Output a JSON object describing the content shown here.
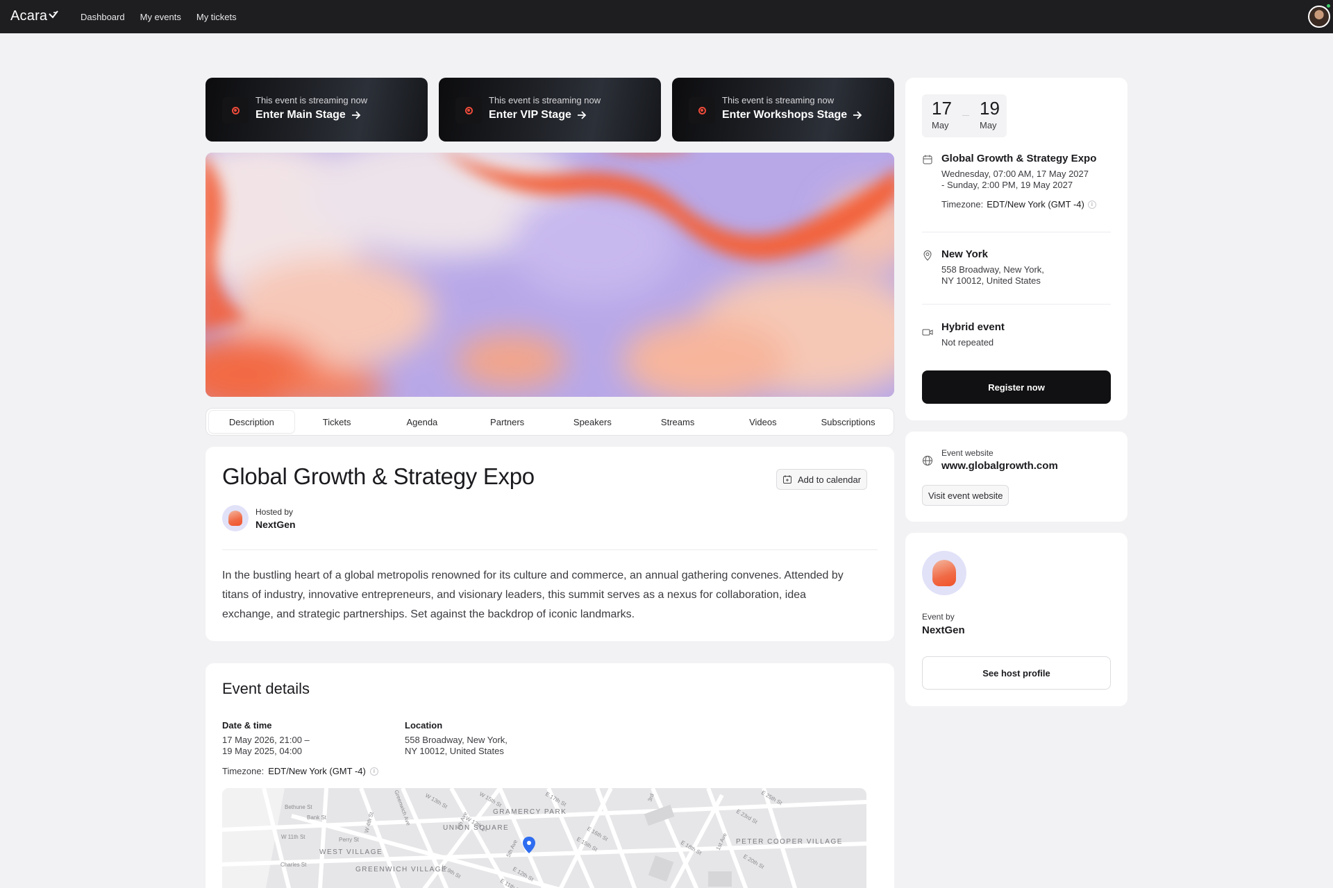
{
  "nav": {
    "logo": "Acara",
    "links": [
      "Dashboard",
      "My events",
      "My tickets"
    ]
  },
  "streams": [
    {
      "status": "This event is streaming now",
      "label": "Enter Main Stage"
    },
    {
      "status": "This event is streaming now",
      "label": "Enter VIP Stage"
    },
    {
      "status": "This event is streaming now",
      "label": "Enter Workshops Stage"
    }
  ],
  "tabs": [
    "Description",
    "Tickets",
    "Agenda",
    "Partners",
    "Speakers",
    "Streams",
    "Videos",
    "Subscriptions"
  ],
  "active_tab": "Description",
  "event": {
    "title": "Global Growth & Strategy Expo",
    "add_to_calendar": "Add to calendar",
    "hosted_by_label": "Hosted by",
    "host": "NextGen",
    "description": "In the bustling heart of a global metropolis renowned for its culture and commerce, an annual gathering convenes. Attended by titans of industry, innovative entrepreneurs, and visionary leaders, this summit serves as a nexus for collaboration, idea exchange, and strategic partnerships. Set against the backdrop of iconic landmarks."
  },
  "details": {
    "heading": "Event details",
    "date_label": "Date & time",
    "date_line1": "17 May 2026, 21:00 –",
    "date_line2": "19 May 2025, 04:00",
    "location_label": "Location",
    "location_line1": "558 Broadway, New York,",
    "location_line2": "NY 10012, United States",
    "timezone_label": "Timezone:",
    "timezone_value": "EDT/New York (GMT -4)",
    "map_labels": [
      "GRAMERCY PARK",
      "UNION SQUARE",
      "WEST VILLAGE",
      "GREENWICH VILLAGE",
      "PETER COOPER VILLAGE",
      "Bethune St",
      "Bank St",
      "W 11th St",
      "Charles St",
      "Perry St",
      "W 4th St",
      "W 13th St",
      "W 15th St",
      "E 17th St",
      "E 23rd St",
      "E 25th St",
      "5th Ave",
      "6th Ave",
      "1st Ave",
      "3rd",
      "E 20th St",
      "E 18th St",
      "E 16th St",
      "E 15th St",
      "W 12th St",
      "W 9th St",
      "E 12th St",
      "E 11th St",
      "Greenwich Ave"
    ]
  },
  "sidebar": {
    "start_day": "17",
    "start_month": "May",
    "end_day": "19",
    "end_month": "May",
    "event_name": "Global Growth & Strategy Expo",
    "datetime_line1": "Wednesday, 07:00 AM, 17 May 2027",
    "datetime_line2": "- Sunday, 2:00 PM, 19 May 2027",
    "timezone_label": "Timezone:",
    "timezone_value": "EDT/New York (GMT -4)",
    "city": "New York",
    "address_line1": "558 Broadway, New York,",
    "address_line2": "NY 10012, United States",
    "format": "Hybrid event",
    "repeat": "Not repeated",
    "register": "Register now",
    "website_label": "Event website",
    "website": "www.globalgrowth.com",
    "visit": "Visit event website",
    "event_by_label": "Event by",
    "event_by": "NextGen",
    "see_host": "See host profile"
  },
  "colors": {
    "topbar": "#1e1e21",
    "accent_orange": "#f05a30",
    "accent_lavender": "#b9a9e6",
    "button_dark": "#111113",
    "live_red": "#f04b3a"
  }
}
